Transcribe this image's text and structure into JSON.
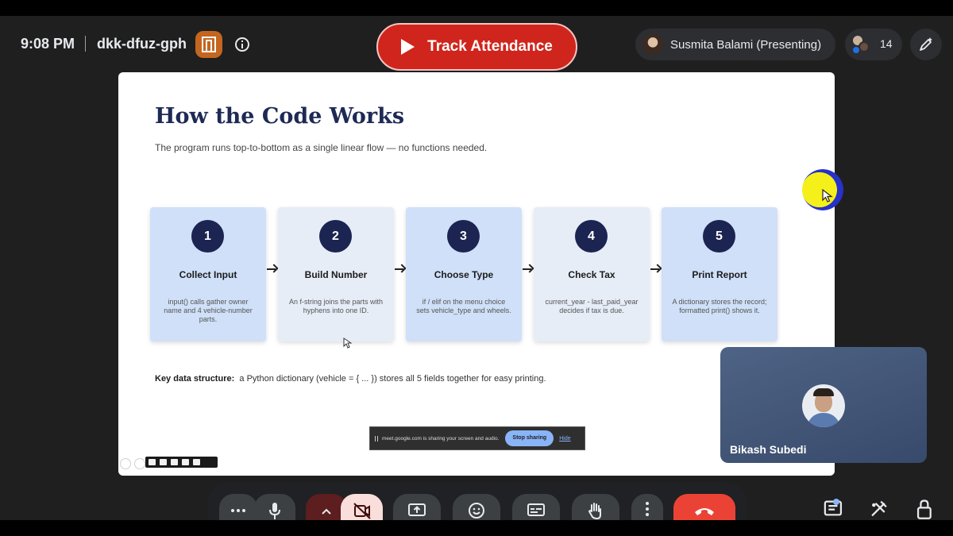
{
  "topbar": {
    "time": "9:08 PM",
    "meeting_code": "dkk-dfuz-gph",
    "attendance_button": "Track Attendance",
    "presenter": "Susmita Balami (Presenting)",
    "people_count": "14"
  },
  "slide": {
    "title": "How the Code Works",
    "subtitle": "The program runs top-to-bottom as a single linear flow — no functions needed.",
    "steps": [
      {
        "num": "1",
        "title": "Collect Input",
        "desc": "input() calls gather owner name and 4 vehicle-number parts."
      },
      {
        "num": "2",
        "title": "Build Number",
        "desc": "An f-string joins the parts with hyphens into one ID."
      },
      {
        "num": "3",
        "title": "Choose Type",
        "desc": "if / elif on the menu choice sets vehicle_type and wheels."
      },
      {
        "num": "4",
        "title": "Check Tax",
        "desc": "current_year - last_paid_year decides if tax is due."
      },
      {
        "num": "5",
        "title": "Print Report",
        "desc": "A dictionary stores the record; formatted print() shows it."
      }
    ],
    "key_label": "Key data structure:",
    "key_text": "a Python dictionary (vehicle = { ... }) stores all 5 fields together for easy printing."
  },
  "share_bar": {
    "message": "meet.google.com is sharing your screen and audio.",
    "stop_label": "Stop sharing",
    "hide_label": "Hide"
  },
  "self_tile": {
    "name": "Bikash Subedi"
  },
  "icons": {
    "topbar": [
      "host-controls-icon",
      "info-icon",
      "play-icon",
      "people-icon",
      "edit-icon"
    ],
    "controls": [
      "more-options-icon",
      "microphone-icon",
      "chevron-up-icon",
      "camera-off-icon",
      "present-screen-icon",
      "emoji-icon",
      "captions-icon",
      "raise-hand-icon",
      "more-vert-icon",
      "end-call-icon"
    ],
    "right_controls": [
      "chat-icon",
      "activities-icon",
      "host-lock-icon"
    ]
  },
  "colors": {
    "attendance_red": "#d0251c",
    "end_call_red": "#ea4335",
    "slide_title_navy": "#1e2a55",
    "step_blue": "#cfe0f8",
    "step_light": "#e6edf7",
    "door_orange": "#c4661f"
  }
}
